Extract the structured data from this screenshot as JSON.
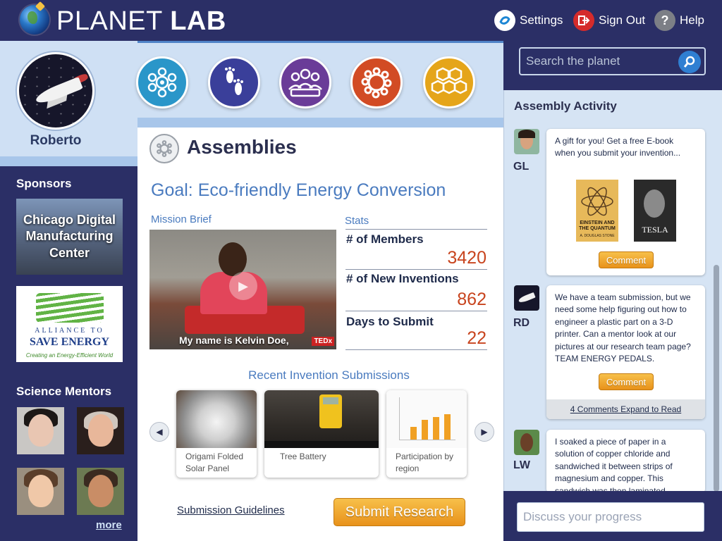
{
  "app": {
    "title_regular": "PLANET",
    "title_bold": "LAB"
  },
  "top_nav": {
    "settings": "Settings",
    "sign_out": "Sign Out",
    "help": "Help",
    "help_glyph": "?"
  },
  "profile": {
    "name": "Roberto"
  },
  "categories": [
    {
      "icon": "network-eye-icon",
      "color": "#2a96c9"
    },
    {
      "icon": "footprints-icon",
      "color": "#3a3f9a"
    },
    {
      "icon": "group-icon",
      "color": "#6a3c98"
    },
    {
      "icon": "ring-icon",
      "color": "#d24b24"
    },
    {
      "icon": "honeycomb-icon",
      "color": "#e5a51a"
    }
  ],
  "sidebar": {
    "sponsors_heading": "Sponsors",
    "sponsor_1": "Chicago Digital Manufacturing Center",
    "sponsor_2": {
      "line1": "ALLIANCE TO",
      "line2": "SAVE ENERGY",
      "line3": "Creating an Energy-Efficient World"
    },
    "mentors_heading": "Science Mentors",
    "more": "more"
  },
  "main": {
    "section_title": "Assemblies",
    "goal": "Goal: Eco-friendly Energy Conversion",
    "mission_brief_label": "Mission Brief",
    "video_caption": "My name is Kelvin Doe,",
    "video_badge": "TEDx",
    "stats_label": "Stats",
    "stats": [
      {
        "name": "# of Members",
        "value": "3420"
      },
      {
        "name": "# of New Inventions",
        "value": "862"
      },
      {
        "name": "Days to Submit",
        "value": "22"
      }
    ],
    "recent_title": "Recent Invention Submissions",
    "submissions": [
      {
        "label_line1": "Origami Folded",
        "label_line2": "Solar Panel"
      },
      {
        "label_line1": "Tree Battery",
        "label_line2": ""
      },
      {
        "label_line1": "Participation by",
        "label_line2": "region"
      }
    ],
    "guidelines_link": "Submission Guidelines",
    "submit_button": "Submit Research"
  },
  "right": {
    "search_placeholder": "Search the planet",
    "activity_title": "Assembly Activity",
    "posts": [
      {
        "initials": "GL",
        "text": "A gift for you!  Get a free E-book when you submit your invention...",
        "books": [
          "EINSTEIN AND THE QUANTUM",
          "TESLA"
        ],
        "book_author": "A. DOUGLAS STONE",
        "comment": "Comment"
      },
      {
        "initials": "RD",
        "text": "We have a team submission, but we need some help figuring out how to engineer a plastic part on a 3-D printer.  Can a mentor look at our pictures at our research team page?  TEAM ENERGY PEDALS.",
        "comment": "Comment",
        "expand": "4 Comments Expand to Read"
      },
      {
        "initials": "LW",
        "text": "I soaked a piece of paper in a solution of copper chloride and sandwiched it between strips of magnesium and copper. This sandwich was then laminated"
      }
    ],
    "discuss_placeholder": "Discuss your progress"
  },
  "colors": {
    "navy": "#2b2f66",
    "light_blue": "#cfe0f4",
    "accent_blue": "#4a7bbf",
    "orange": "#e8921b",
    "stat_red": "#c8441e"
  }
}
